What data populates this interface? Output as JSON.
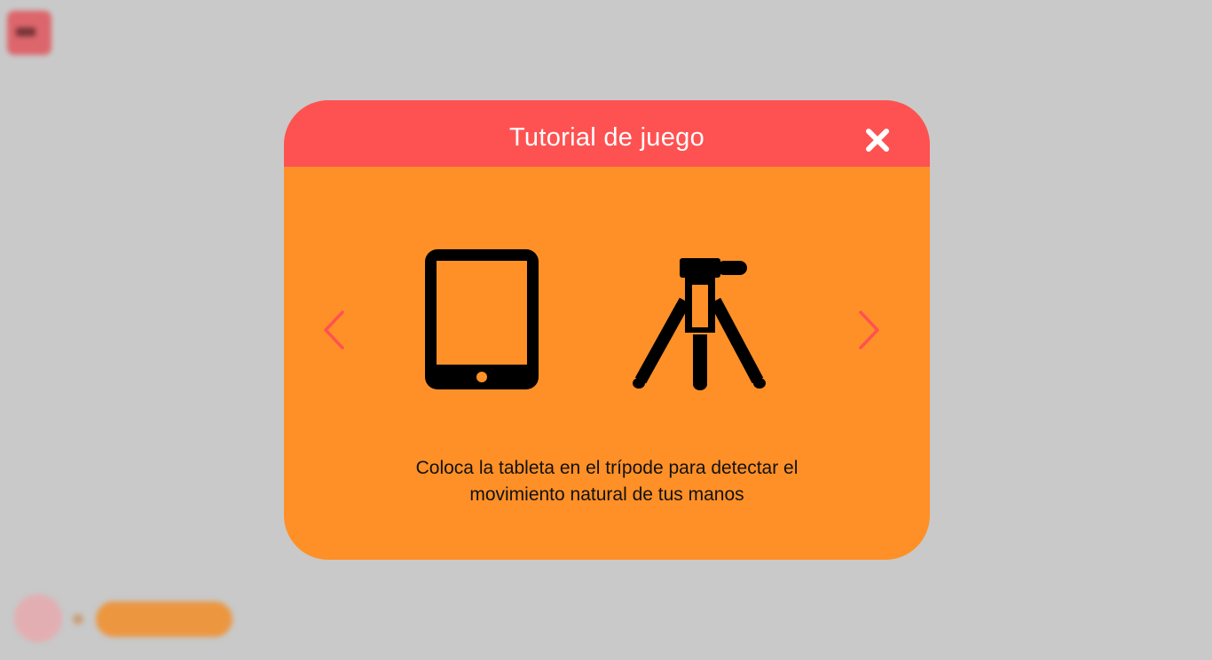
{
  "background": {
    "timer_button": {
      "icon": "clock-icon"
    },
    "back_button": {
      "icon": "back-arrow-icon"
    },
    "action_pill": {
      "label": ""
    }
  },
  "modal": {
    "title": "Tutorial de juego",
    "close_icon": "close-icon",
    "prev_icon": "chevron-left-icon",
    "next_icon": "chevron-right-icon",
    "slide": {
      "icons": [
        "tablet-icon",
        "tripod-icon"
      ],
      "caption_line1": "Coloca la tableta en el trípode para detectar el",
      "caption_line2": "movimiento natural de tus manos"
    }
  },
  "colors": {
    "overlay": "#c9c9c9",
    "header": "#fe5252",
    "body": "#ff9027",
    "nav_arrow": "#fe5252",
    "icon": "#000000",
    "title_text": "#ffffff"
  }
}
